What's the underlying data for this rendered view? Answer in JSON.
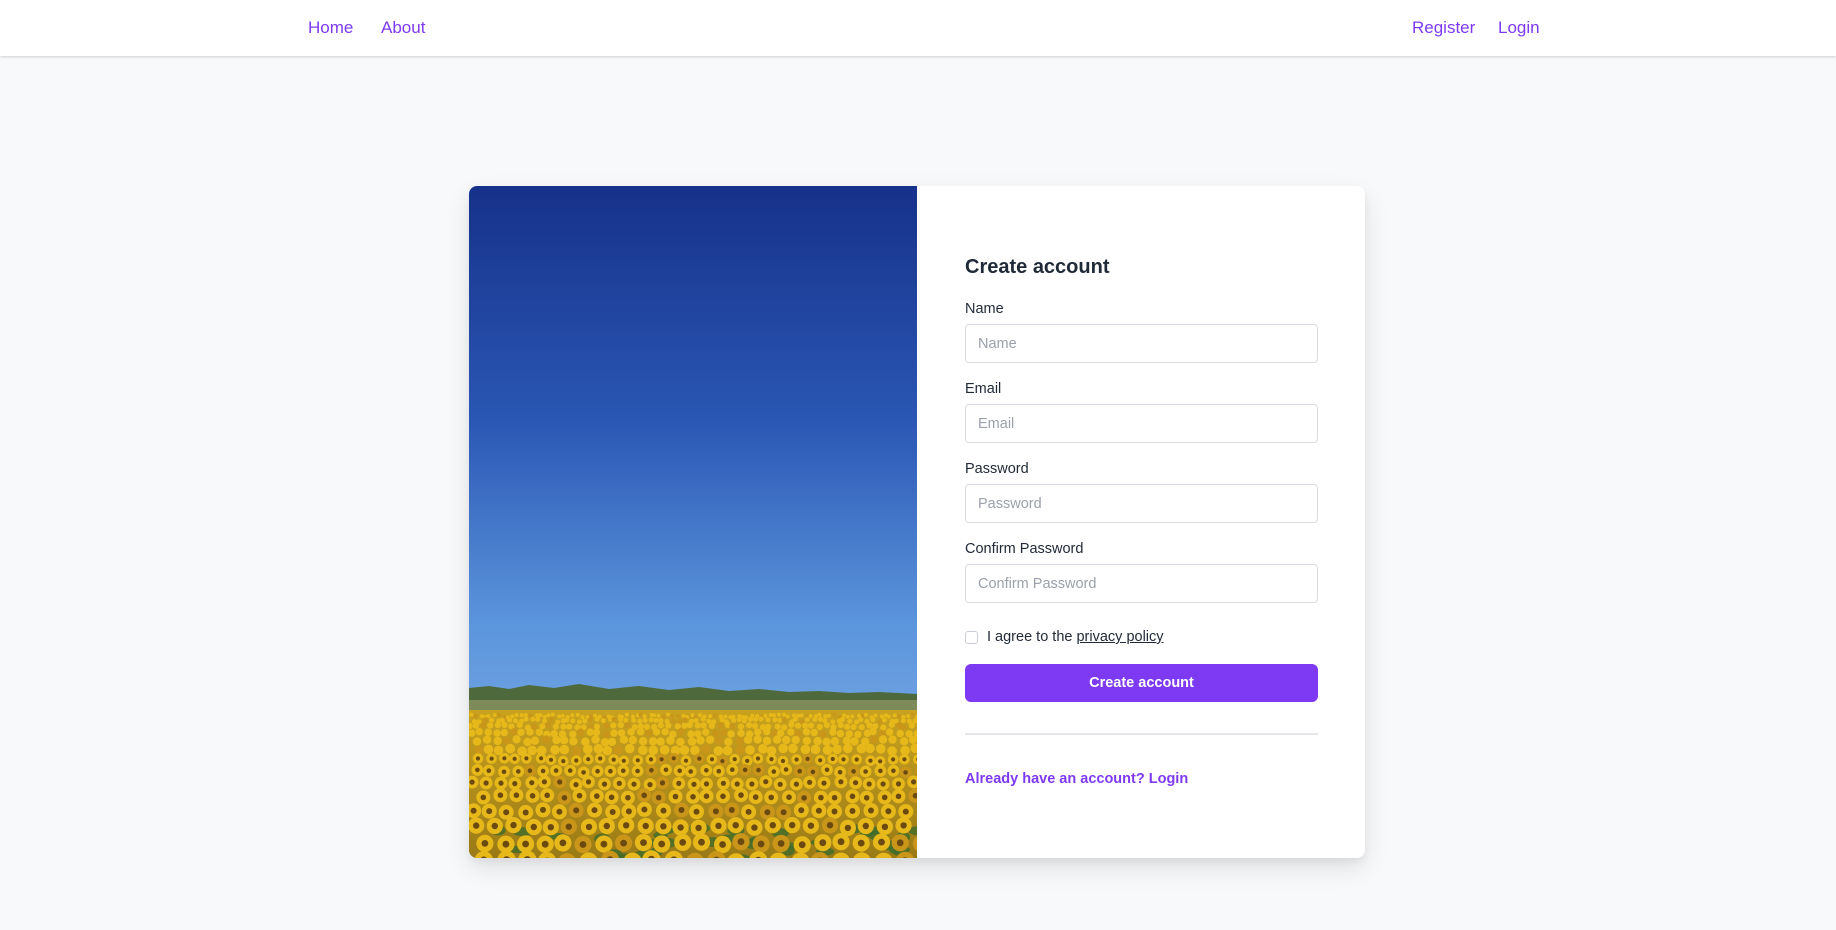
{
  "nav": {
    "left": [
      "Home",
      "About"
    ],
    "right": [
      "Register",
      "Login"
    ]
  },
  "form": {
    "title": "Create account",
    "fields": [
      {
        "label": "Name",
        "placeholder": "Name"
      },
      {
        "label": "Email",
        "placeholder": "Email"
      },
      {
        "label": "Password",
        "placeholder": "Password"
      },
      {
        "label": "Confirm Password",
        "placeholder": "Confirm Password"
      }
    ],
    "agree_prefix": "I agree to the ",
    "agree_link": "privacy policy",
    "submit_label": "Create account",
    "login_link": "Already have an account? Login"
  },
  "colors": {
    "accent": "#7e3af2",
    "background": "#f8f9fb",
    "sky_top": "#16318a",
    "sky_bottom": "#8bb6ea",
    "sunflower": "#e7b81a"
  }
}
